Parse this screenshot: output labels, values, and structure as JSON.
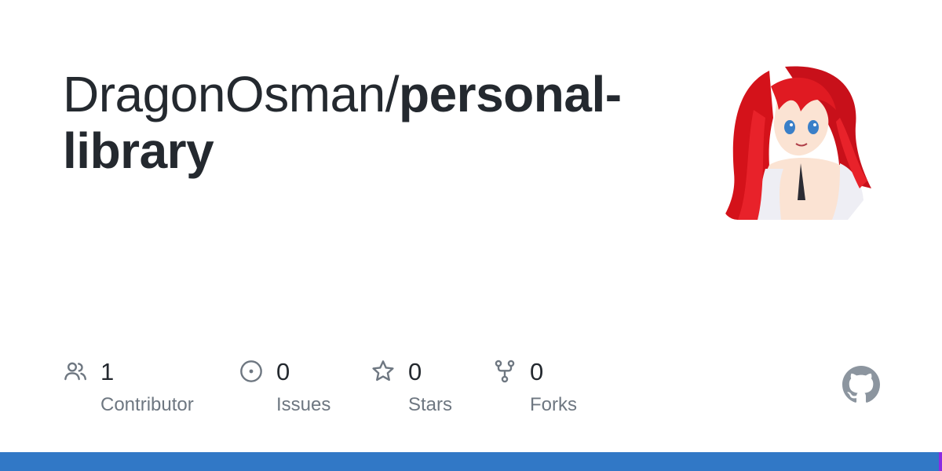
{
  "repo": {
    "owner": "DragonOsman/",
    "name": "personal-library"
  },
  "avatar": {
    "alt": "DragonOsman avatar"
  },
  "stats": {
    "contributors": {
      "count": "1",
      "label": "Contributor",
      "icon": "people-icon"
    },
    "issues": {
      "count": "0",
      "label": "Issues",
      "icon": "issue-opened-icon"
    },
    "stars": {
      "count": "0",
      "label": "Stars",
      "icon": "star-icon"
    },
    "forks": {
      "count": "0",
      "label": "Forks",
      "icon": "repo-forked-icon"
    }
  },
  "footer": {
    "language_colors": [
      "#3178c6",
      "#8a2be2"
    ]
  },
  "brand": {
    "mark": "github-mark-icon",
    "icon_color": "#8c959f"
  }
}
